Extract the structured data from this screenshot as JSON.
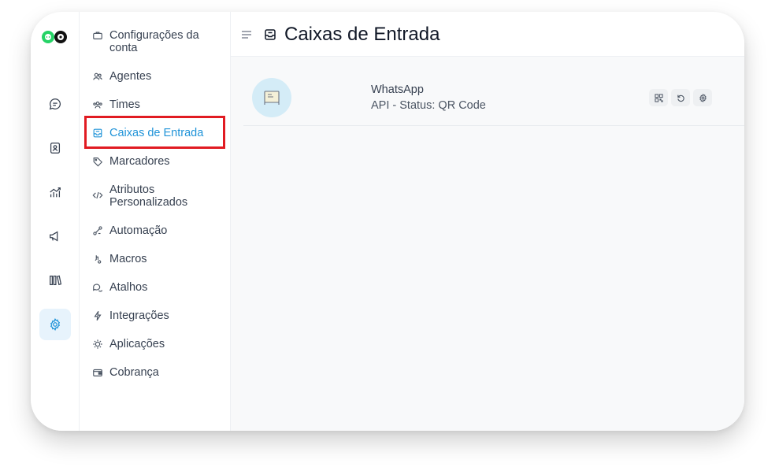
{
  "rail": {
    "items": [
      {
        "icon": "chat-icon"
      },
      {
        "icon": "contacts-icon"
      },
      {
        "icon": "reports-icon"
      },
      {
        "icon": "campaigns-icon"
      },
      {
        "icon": "library-icon"
      },
      {
        "icon": "settings-gear-icon",
        "active": true
      }
    ]
  },
  "sidebar": {
    "items": [
      {
        "label": "Configurações da conta",
        "icon": "briefcase-icon"
      },
      {
        "label": "Agentes",
        "icon": "people-icon"
      },
      {
        "label": "Times",
        "icon": "team-icon"
      },
      {
        "label": "Caixas de Entrada",
        "icon": "inbox-icon",
        "active": true
      },
      {
        "label": "Marcadores",
        "icon": "tag-icon"
      },
      {
        "label": "Atributos Personalizados",
        "icon": "code-icon"
      },
      {
        "label": "Automação",
        "icon": "automation-icon"
      },
      {
        "label": "Macros",
        "icon": "macro-icon"
      },
      {
        "label": "Atalhos",
        "icon": "speech-bubbles-icon"
      },
      {
        "label": "Integrações",
        "icon": "flash-icon"
      },
      {
        "label": "Aplicações",
        "icon": "puzzle-icon"
      },
      {
        "label": "Cobrança",
        "icon": "wallet-icon"
      }
    ]
  },
  "header": {
    "title": "Caixas de Entrada"
  },
  "inboxes": [
    {
      "name": "WhatsApp",
      "status": "API - Status: QR Code",
      "actions": [
        "qr-code-icon",
        "refresh-icon",
        "settings-icon"
      ]
    }
  ],
  "colors": {
    "accent": "#1f93d8",
    "highlight": "#e11b22",
    "logo_green": "#25d366"
  }
}
